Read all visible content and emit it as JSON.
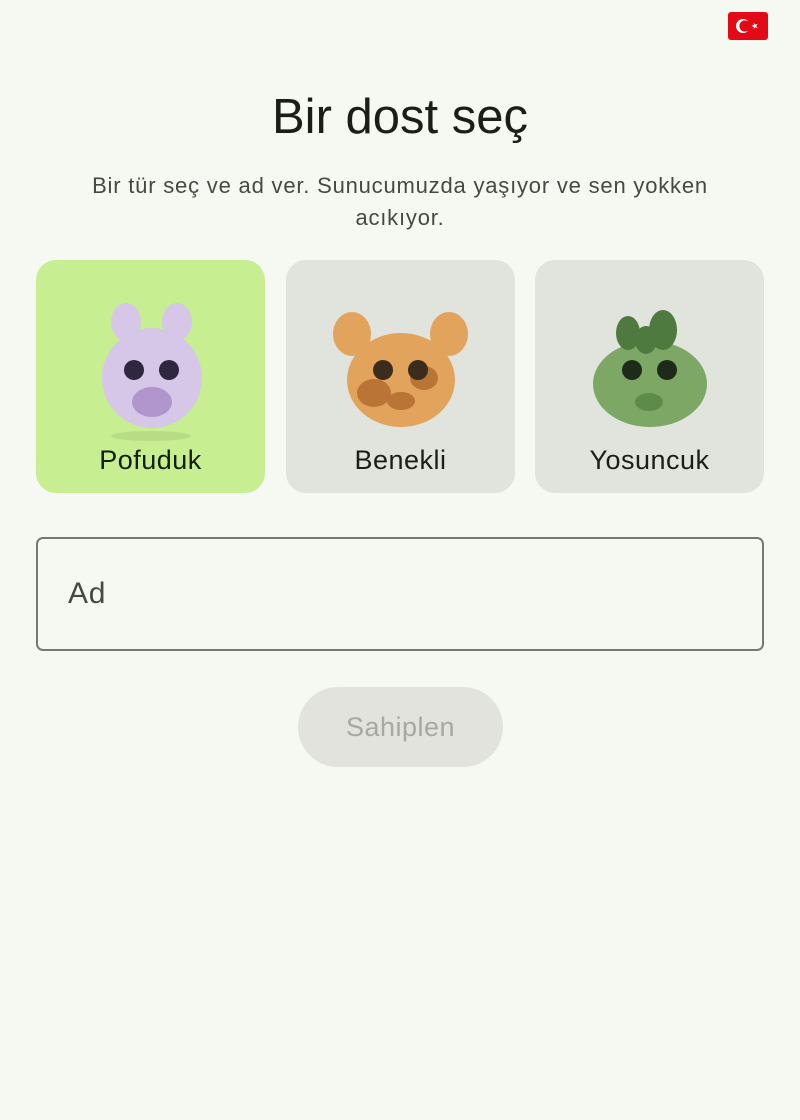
{
  "language": {
    "flag_icon": "turkey-flag-icon",
    "colors": {
      "red": "#e30a17",
      "white": "#ffffff"
    }
  },
  "header": {
    "title": "Bir dost seç",
    "subtitle": "Bir tür seç ve ad ver. Sunucumuzda yaşıyor ve sen yokken acıkıyor."
  },
  "species": [
    {
      "label": "Pofuduk",
      "selected": true,
      "color": "#d6c6e8",
      "icon": "bunny-pet-icon"
    },
    {
      "label": "Benekli",
      "selected": false,
      "color": "#e2a45c",
      "icon": "spotted-pet-icon"
    },
    {
      "label": "Yosuncuk",
      "selected": false,
      "color": "#7da765",
      "icon": "moss-pet-icon"
    }
  ],
  "name_field": {
    "placeholder": "Ad",
    "value": ""
  },
  "adopt_button": {
    "label": "Sahiplen",
    "enabled": false
  },
  "colors": {
    "background": "#f6f9f1",
    "selected_card": "#c7ef92",
    "card": "#e1e3dd",
    "outline": "#75796f"
  }
}
